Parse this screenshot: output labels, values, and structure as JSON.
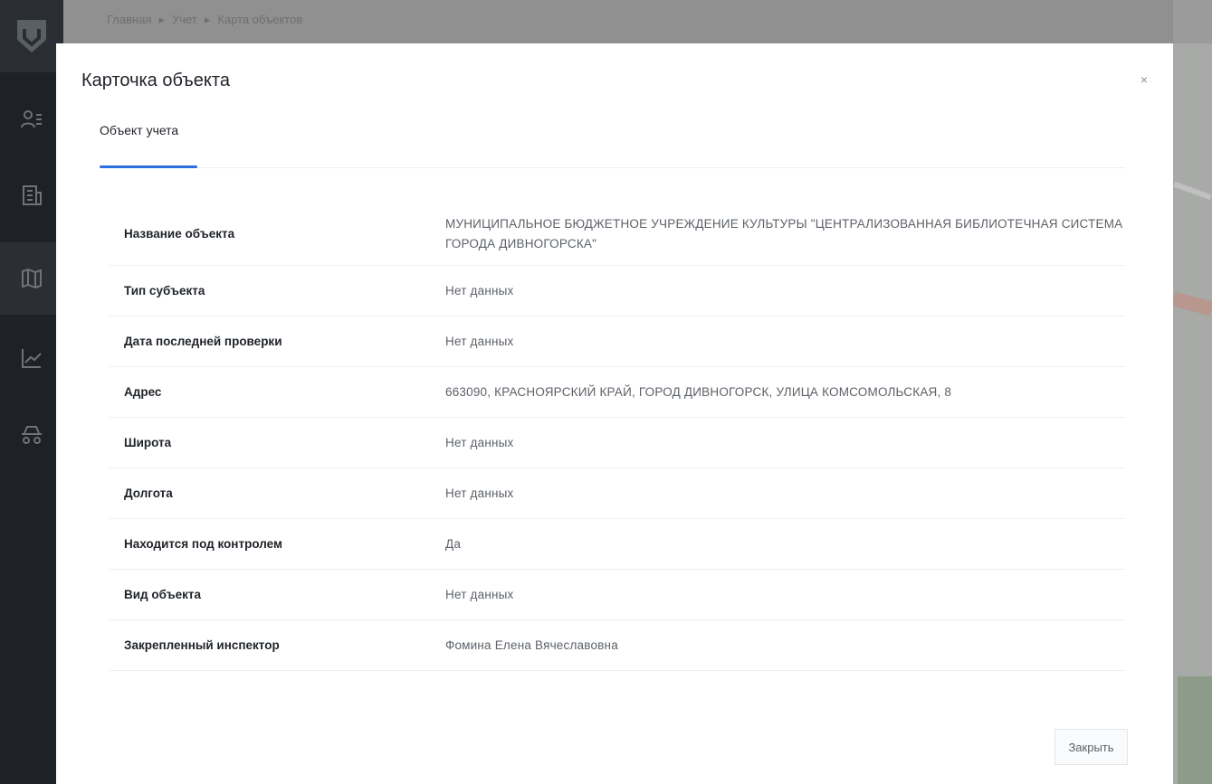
{
  "breadcrumb": [
    "Главная",
    "Учет",
    "Карта объектов"
  ],
  "breadcrumb_separator": "▸",
  "sidebar": {
    "items": [
      {
        "icon": "users-icon"
      },
      {
        "icon": "building-icon"
      },
      {
        "icon": "map-icon"
      },
      {
        "icon": "chart-icon"
      },
      {
        "icon": "car-icon"
      }
    ],
    "active_index": 2
  },
  "modal": {
    "title": "Карточка объекта",
    "close_glyph": "×",
    "tabs": [
      {
        "label": "Объект учета",
        "active": true
      }
    ],
    "fields": [
      {
        "label": "Название объекта",
        "value": "МУНИЦИПАЛЬНОЕ БЮДЖЕТНОЕ УЧРЕЖДЕНИЕ КУЛЬТУРЫ \"ЦЕНТРАЛИЗОВАННАЯ БИБЛИОТЕЧНАЯ СИСТЕМА ГОРОДА ДИВНОГОРСКА\""
      },
      {
        "label": "Тип субъекта",
        "value": "Нет данных"
      },
      {
        "label": "Дата последней проверки",
        "value": "Нет данных"
      },
      {
        "label": "Адрес",
        "value": "663090, КРАСНОЯРСКИЙ КРАЙ, ГОРОД ДИВНОГОРСК, УЛИЦА КОМСОМОЛЬСКАЯ, 8"
      },
      {
        "label": "Широта",
        "value": "Нет данных"
      },
      {
        "label": "Долгота",
        "value": "Нет данных"
      },
      {
        "label": "Находится под контролем",
        "value": "Да"
      },
      {
        "label": "Вид объекта",
        "value": "Нет данных"
      },
      {
        "label": "Закрепленный инспектор",
        "value": "Фомина Елена Вячеславовна"
      }
    ],
    "close_button_label": "Закрыть"
  },
  "colors": {
    "accent": "#2a6ee0",
    "sidebar_bg": "#1e2126",
    "overlay": "#8a8a8a"
  }
}
